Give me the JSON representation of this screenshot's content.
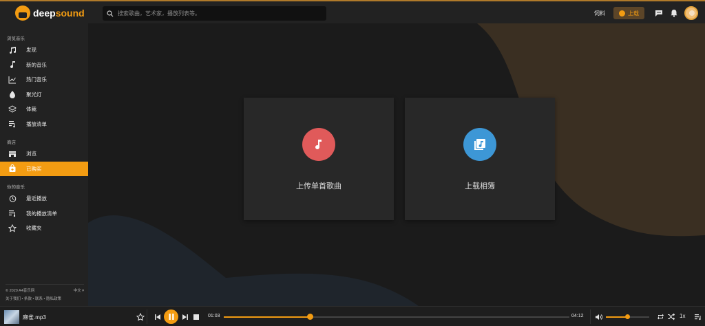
{
  "brand": {
    "part1": "deep",
    "part2": "sound",
    "accent": "#f39c12"
  },
  "search": {
    "placeholder": "搜索歌曲，艺术家，播放列表等。"
  },
  "header": {
    "link_label": "饲料",
    "upload_label": "上载"
  },
  "sidebar": {
    "sections": [
      {
        "title": "浏览音乐",
        "items": [
          {
            "label": "发现",
            "icon": "music-notes-icon"
          },
          {
            "label": "新的音乐",
            "icon": "music-note-icon"
          },
          {
            "label": "热门音乐",
            "icon": "trending-chart-icon"
          },
          {
            "label": "聚光灯",
            "icon": "drop-icon"
          },
          {
            "label": "体裁",
            "icon": "layers-icon"
          },
          {
            "label": "播放清单",
            "icon": "playlist-icon"
          }
        ]
      },
      {
        "title": "商店",
        "items": [
          {
            "label": "浏览",
            "icon": "store-icon"
          },
          {
            "label": "已购买",
            "icon": "purchased-bag-icon",
            "active": true
          }
        ]
      },
      {
        "title": "你的音乐",
        "items": [
          {
            "label": "最近播放",
            "icon": "history-icon"
          },
          {
            "label": "我的播放清单",
            "icon": "my-playlist-icon"
          },
          {
            "label": "收藏夹",
            "icon": "star-icon"
          }
        ]
      }
    ],
    "footer": {
      "copyright": "© 2020 A4音乐网",
      "language": "中文 ▾",
      "links": "关于我们 • 条款 • 联系 • 隐私政策"
    }
  },
  "cards": [
    {
      "label": "上传单首歌曲",
      "color": "#e05a5a",
      "icon": "music-note-icon"
    },
    {
      "label": "上载相簿",
      "color": "#3d97d6",
      "icon": "album-icon"
    }
  ],
  "player": {
    "track": "麻雀.mp3",
    "current_time": "01:03",
    "total_time": "04:12",
    "progress": 0.25,
    "volume": 0.5,
    "speed": "1x"
  },
  "colors": {
    "accent": "#f39c12",
    "background": "#1b1b1b",
    "panel": "#222222"
  }
}
